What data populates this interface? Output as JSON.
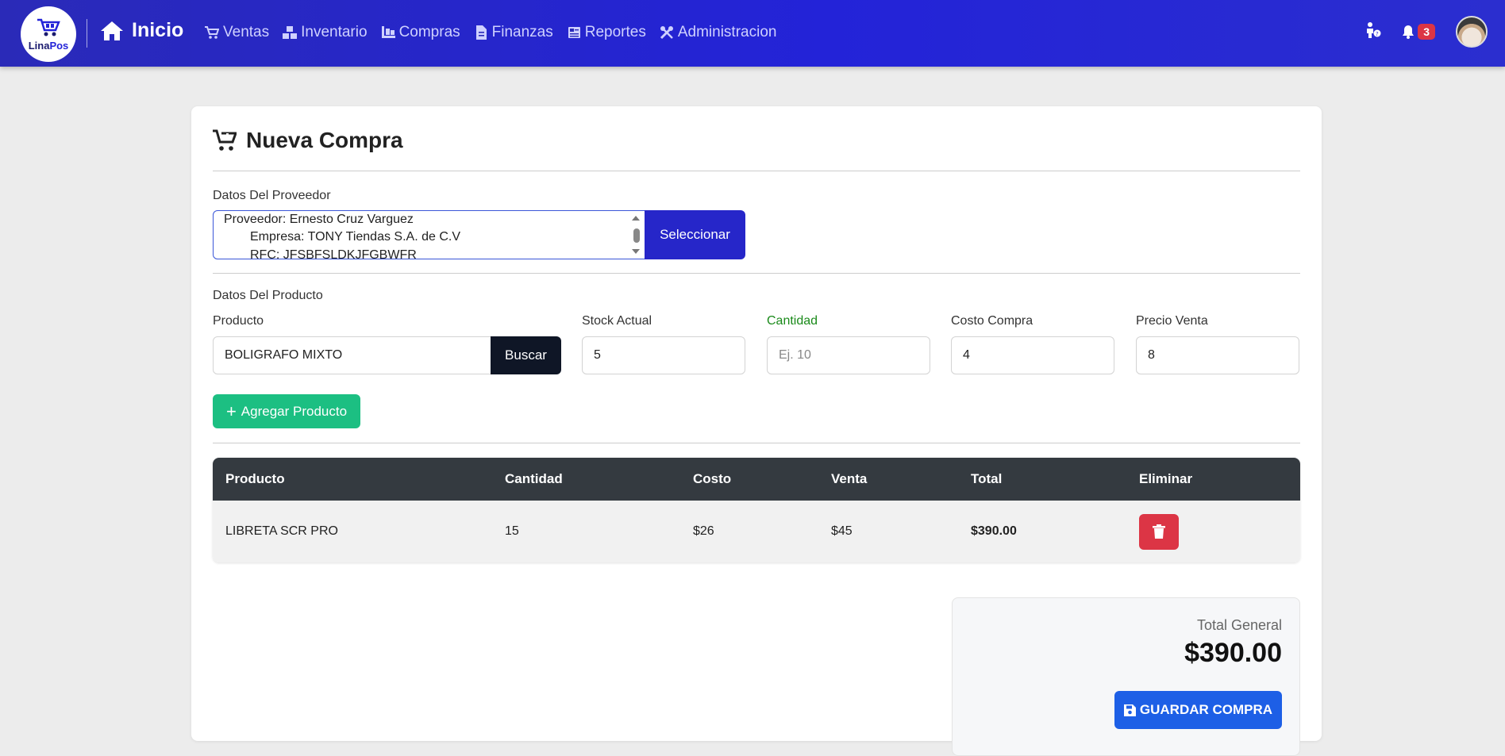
{
  "navbar": {
    "logo_text_a": "Lina",
    "logo_text_b": "Pos",
    "home_label": "Inicio",
    "links": [
      {
        "label": "Ventas",
        "icon": "cart-icon"
      },
      {
        "label": "Inventario",
        "icon": "boxes-icon"
      },
      {
        "label": "Compras",
        "icon": "dolly-icon"
      },
      {
        "label": "Finanzas",
        "icon": "invoice-icon"
      },
      {
        "label": "Reportes",
        "icon": "newspaper-icon"
      },
      {
        "label": "Administracion",
        "icon": "tools-icon"
      }
    ],
    "notifications_count": "3"
  },
  "page": {
    "title": "Nueva Compra",
    "supplier_section_label": "Datos Del Proveedor",
    "supplier_lines": [
      "Proveedor: Ernesto Cruz Varguez",
      "Empresa: TONY Tiendas S.A. de C.V",
      "RFC: JFSBFSLDKJFGBWFR"
    ],
    "select_button": "Seleccionar",
    "product_section_label": "Datos Del Producto",
    "fields": {
      "producto_label": "Producto",
      "producto_value": "BOLIGRAFO MIXTO",
      "buscar_button": "Buscar",
      "stock_label": "Stock Actual",
      "stock_value": "5",
      "cantidad_label": "Cantidad",
      "cantidad_placeholder": "Ej. 10",
      "costo_label": "Costo Compra",
      "costo_value": "4",
      "precio_label": "Precio Venta",
      "precio_value": "8"
    },
    "add_button": "Agregar Producto",
    "table": {
      "headers": [
        "Producto",
        "Cantidad",
        "Costo",
        "Venta",
        "Total",
        "Eliminar"
      ],
      "rows": [
        {
          "producto": "LIBRETA SCR PRO",
          "cantidad": "15",
          "costo": "$26",
          "venta": "$45",
          "total": "$390.00"
        }
      ]
    },
    "total_label": "Total General",
    "total_value": "$390.00",
    "save_button": "GUARDAR COMPRA"
  }
}
